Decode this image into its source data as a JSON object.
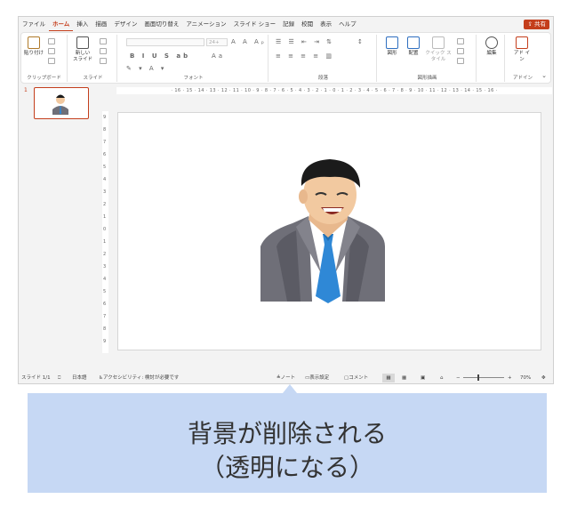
{
  "tabs": [
    "ファイル",
    "ホーム",
    "挿入",
    "描画",
    "デザイン",
    "画面切り替え",
    "アニメーション",
    "スライド ショー",
    "記録",
    "校閲",
    "表示",
    "ヘルプ"
  ],
  "active_tab": "ホーム",
  "share_label": "共有",
  "ribbon": {
    "clipboard": {
      "paste": "貼り付け",
      "label": "クリップボード"
    },
    "slides": {
      "new_slide": "新しい スライド",
      "label": "スライド"
    },
    "font": {
      "label": "フォント",
      "size": "24+",
      "format_glyphs": "B I U S ab",
      "aa": "Aa"
    },
    "paragraph": {
      "label": "段落"
    },
    "drawing": {
      "shape": "図形",
      "arrange": "配置",
      "quick_style": "クイック スタイル",
      "label": "図形描画"
    },
    "editing": {
      "edit": "編集"
    },
    "addin": {
      "addin": "アド イン",
      "label": "アドイン"
    }
  },
  "ruler_text": "· 16 · 15 · 14 · 13 · 12 · 11 · 10 · 9 · 8 · 7 · 6 · 5 · 4 · 3 · 2 · 1 · 0 · 1 · 2 · 3 · 4 · 5 · 6 · 7 · 8 · 9 · 10 · 11 · 12 · 13 · 14 · 15 · 16 ·",
  "vruler": [
    "9",
    "8",
    "7",
    "6",
    "5",
    "4",
    "3",
    "2",
    "1",
    "0",
    "1",
    "2",
    "3",
    "4",
    "5",
    "6",
    "7",
    "8",
    "9"
  ],
  "thumbnail_number": "1",
  "status": {
    "slide": "スライド 1/1",
    "language": "日本語",
    "accessibility": "アクセシビリティ: 検討が必要です",
    "notes": "ノート",
    "display": "表示設定",
    "comments": "コメント",
    "zoom": "70%"
  },
  "callout": {
    "line1": "背景が削除される",
    "line2": "（透明になる）"
  },
  "colors": {
    "accent": "#c43e1c",
    "callout_bg": "#c6d8f4",
    "suit": "#6f6f78",
    "tie": "#2f88d6"
  }
}
